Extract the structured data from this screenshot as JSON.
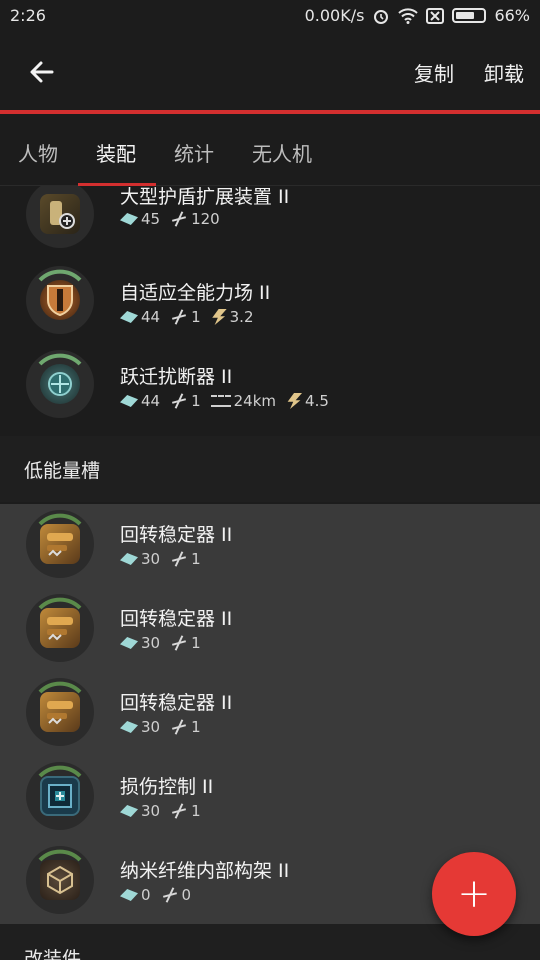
{
  "status_bar": {
    "time": "2:26",
    "speed": "0.00K/s",
    "battery": "66%"
  },
  "app_bar": {
    "copy_label": "复制",
    "unload_label": "卸载"
  },
  "tabs": [
    {
      "label": "人物"
    },
    {
      "label": "装配"
    },
    {
      "label": "统计"
    },
    {
      "label": "无人机"
    }
  ],
  "mid_modules": [
    {
      "name": "大型护盾扩展装置 II",
      "cpu": "45",
      "pg": "120"
    },
    {
      "name": "自适应全能力场 II",
      "cpu": "44",
      "pg": "1",
      "cap": "3.2"
    },
    {
      "name": "跃迁扰断器 II",
      "cpu": "44",
      "pg": "1",
      "range": "24km",
      "cap": "4.5"
    }
  ],
  "low_section": {
    "title": "低能量槽"
  },
  "low_modules": [
    {
      "name": "回转稳定器 II",
      "cpu": "30",
      "pg": "1"
    },
    {
      "name": "回转稳定器 II",
      "cpu": "30",
      "pg": "1"
    },
    {
      "name": "回转稳定器 II",
      "cpu": "30",
      "pg": "1"
    },
    {
      "name": "损伤控制 II",
      "cpu": "30",
      "pg": "1"
    },
    {
      "name": "纳米纤维内部构架 II",
      "cpu": "0",
      "pg": "0"
    }
  ],
  "rig_section": {
    "title": "改装件"
  },
  "fab": {
    "label": "+"
  },
  "icons": {
    "back": "arrow-left-icon",
    "add": "plus-icon"
  },
  "colors": {
    "accent": "#d32f2f",
    "fab": "#e53935"
  }
}
